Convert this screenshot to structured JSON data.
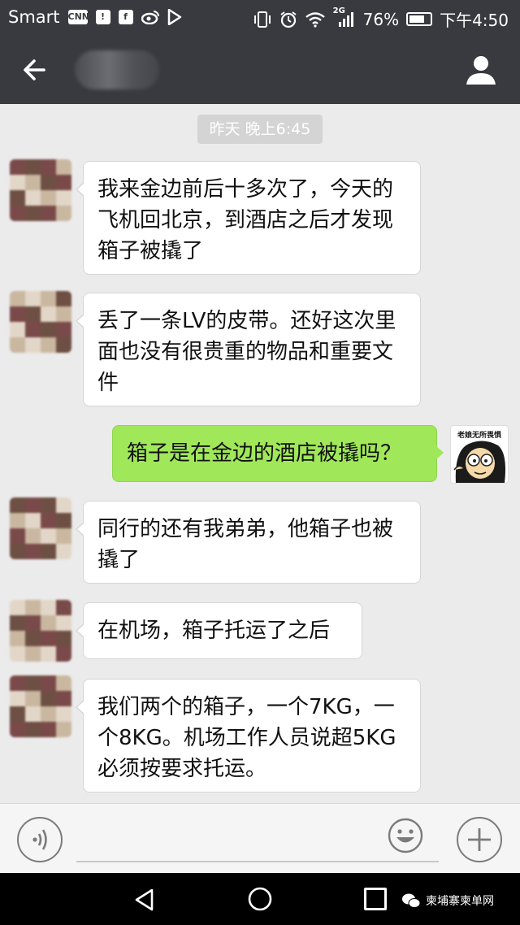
{
  "status_bar": {
    "carrier": "Smart",
    "icons_left": [
      "cnn-icon",
      "sim-alert-icon",
      "facebook-icon",
      "weibo-icon",
      "play-store-icon"
    ],
    "icons_right": [
      "vibrate-icon",
      "alarm-icon",
      "wifi-icon",
      "signal-icon"
    ],
    "network": "2G",
    "battery": "76%",
    "battery_level": 0.76,
    "time": "下午4:50"
  },
  "title_bar": {
    "back_icon": "arrow-left-icon",
    "contact_name": "",
    "profile_icon": "person-icon"
  },
  "chat": {
    "timestamp": "昨天 晚上6:45",
    "messages": [
      {
        "side": "left",
        "text": "我来金边前后十多次了，今天的飞机回北京，到酒店之后才发现箱子被撬了"
      },
      {
        "side": "left",
        "text": "丢了一条LV的皮带。还好这次里面也没有很贵重的物品和重要文件"
      },
      {
        "side": "right",
        "text": "箱子是在金边的酒店被撬吗？"
      },
      {
        "side": "left",
        "text": "同行的还有我弟弟，他箱子也被撬了"
      },
      {
        "side": "left",
        "text": "在机场，箱子托运了之后"
      },
      {
        "side": "left",
        "text": "我们两个的箱子，一个7KG，一个8KG。机场工作人员说超5KG必须按要求托运。"
      }
    ],
    "my_avatar_caption": "老娘无所畏惧"
  },
  "input_bar": {
    "voice_icon": "voice-icon",
    "input_value": "",
    "emoji_icon": "emoji-icon",
    "plus_icon": "plus-icon"
  },
  "nav_bar": {
    "watermark": "柬埔寨柬单网"
  },
  "colors": {
    "header": "#393a3f",
    "chat_background": "#ebebeb",
    "my_bubble": "#a0e75a",
    "their_bubble": "#ffffff"
  }
}
